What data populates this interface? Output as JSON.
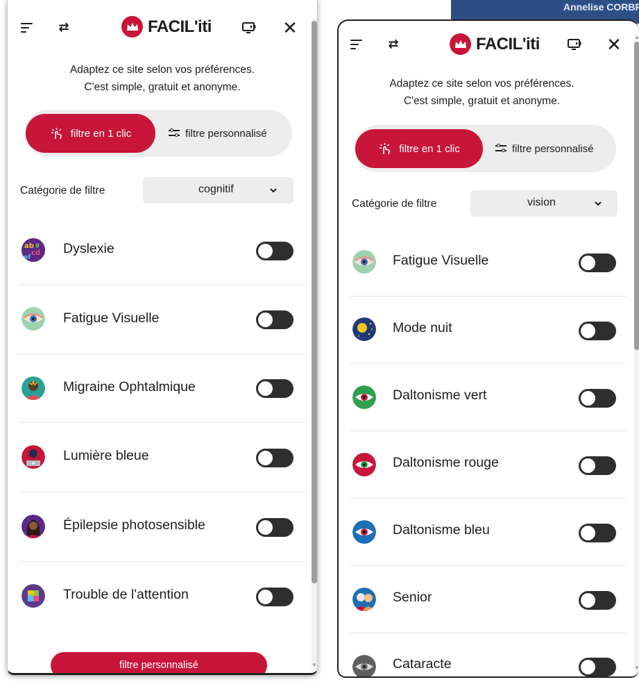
{
  "background_bar": {
    "text": "Annelise CORBRION"
  },
  "colors": {
    "accent": "#c8153a",
    "toggle_off": "#2e2e2e",
    "pill_bg": "#ededed"
  },
  "panels": [
    {
      "logo": "FACIL'iti",
      "intro_line1": "Adaptez ce site selon vos préférences.",
      "intro_line2": "C'est simple, gratuit et anonyme.",
      "mode_one_click": "filtre en 1 clic",
      "mode_custom": "filtre personnalisé",
      "category_label": "Catégorie de filtre",
      "category_value": "cognitif",
      "items": [
        {
          "label": "Dyslexie",
          "icon": "dyslexia-icon",
          "enabled": false
        },
        {
          "label": "Fatigue Visuelle",
          "icon": "eye-fatigue-icon",
          "enabled": false
        },
        {
          "label": "Migraine Ophtalmique",
          "icon": "migraine-icon",
          "enabled": false
        },
        {
          "label": "Lumière bleue",
          "icon": "blue-light-icon",
          "enabled": false
        },
        {
          "label": "Épilepsie photosensible",
          "icon": "epilepsy-icon",
          "enabled": false
        },
        {
          "label": "Trouble de l'attention",
          "icon": "puzzle-icon",
          "enabled": false
        }
      ],
      "bottom_button": "filtre personnalisé"
    },
    {
      "logo": "FACIL'iti",
      "intro_line1": "Adaptez ce site selon vos préférences.",
      "intro_line2": "C'est simple, gratuit et anonyme.",
      "mode_one_click": "filtre en 1 clic",
      "mode_custom": "filtre personnalisé",
      "category_label": "Catégorie de filtre",
      "category_value": "vision",
      "items": [
        {
          "label": "Fatigue Visuelle",
          "icon": "eye-fatigue-icon",
          "enabled": false
        },
        {
          "label": "Mode nuit",
          "icon": "night-mode-icon",
          "enabled": false
        },
        {
          "label": "Daltonisme vert",
          "icon": "green-eye-icon",
          "enabled": false
        },
        {
          "label": "Daltonisme rouge",
          "icon": "red-eye-icon",
          "enabled": false
        },
        {
          "label": "Daltonisme bleu",
          "icon": "blue-eye-icon",
          "enabled": false
        },
        {
          "label": "Senior",
          "icon": "senior-icon",
          "enabled": false
        },
        {
          "label": "Cataracte",
          "icon": "cataract-icon",
          "enabled": false
        }
      ]
    }
  ]
}
